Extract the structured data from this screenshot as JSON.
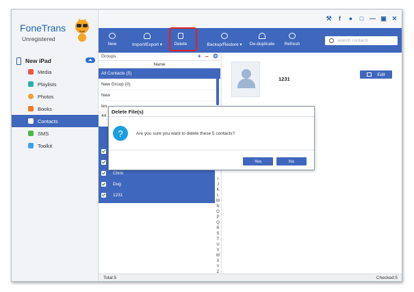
{
  "app": {
    "name": "FoneTrans",
    "subtitle": "Unregistered"
  },
  "device": {
    "label": "New iPad"
  },
  "sidebar": {
    "items": [
      {
        "label": "Media",
        "color": "#e9573f"
      },
      {
        "label": "Playlists",
        "color": "#2bb0a5"
      },
      {
        "label": "Photos",
        "color": "#f0a22e"
      },
      {
        "label": "Books",
        "color": "#f07a22"
      },
      {
        "label": "Contacts",
        "color": "#ffffff"
      },
      {
        "label": "SMS",
        "color": "#4cb848"
      },
      {
        "label": "Toolkit",
        "color": "#3fa2e8"
      }
    ]
  },
  "toolbar": {
    "new": "New",
    "import_export": "Import/Export",
    "delete": "Delete",
    "backup_restore": "Backup/Restore",
    "deduplicate": "De-duplicate",
    "refresh": "Refresh"
  },
  "search": {
    "placeholder": "search contacts"
  },
  "groups": {
    "header": "Groups",
    "name_column": "Name",
    "items": [
      "All Contacts  (5)",
      "New Group  (0)",
      "New",
      "tes",
      "44"
    ]
  },
  "contacts": [
    "",
    "",
    "Chris",
    "Dug",
    "1231"
  ],
  "alphabet": [
    "I",
    "J",
    "K",
    "L",
    "M",
    "N",
    "O",
    "P",
    "Q",
    "R",
    "S",
    "T",
    "U",
    "V",
    "W",
    "X",
    "Y",
    "Z",
    "#"
  ],
  "detail": {
    "name": "1231",
    "edit": "Edit"
  },
  "dialog": {
    "title": "Delete File(s)",
    "message": "Are you sure you want to delete these 5 contacts?",
    "yes": "Yes",
    "no": "No"
  },
  "status": {
    "total": "Total:5",
    "checked": "Checked:5"
  },
  "colors": {
    "accent": "#3f67bd",
    "highlight": "#e52025"
  }
}
